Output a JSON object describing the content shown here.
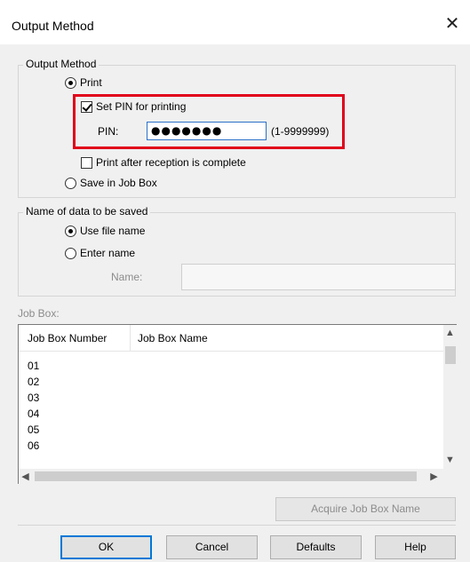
{
  "window": {
    "title": "Output Method",
    "close_glyph": "✕"
  },
  "output_method": {
    "legend": "Output Method",
    "print_label": "Print",
    "print_selected": true,
    "set_pin_label": "Set PIN for printing",
    "set_pin_checked": true,
    "pin_label": "PIN:",
    "pin_value": "●●●●●●●",
    "pin_range": "(1-9999999)",
    "print_after_label": "Print after reception is complete",
    "print_after_checked": false,
    "save_job_box_label": "Save in Job Box",
    "save_job_box_selected": false
  },
  "name_of_data": {
    "legend": "Name of data to be saved",
    "use_file_name_label": "Use file name",
    "use_file_name_selected": true,
    "enter_name_label": "Enter name",
    "enter_name_selected": false,
    "name_label": "Name:",
    "name_value": ""
  },
  "job_box": {
    "label": "Job Box:",
    "columns": [
      "Job Box Number",
      "Job Box Name"
    ],
    "rows": [
      "01",
      "02",
      "03",
      "04",
      "05",
      "06"
    ]
  },
  "buttons": {
    "acquire": "Acquire Job Box Name",
    "ok": "OK",
    "cancel": "Cancel",
    "defaults": "Defaults",
    "help": "Help"
  },
  "colors": {
    "highlight": "#e0001a",
    "focus": "#2b70c9"
  },
  "icons": {
    "close": "close-icon",
    "scroll_up": "chevron-up-icon",
    "scroll_down": "chevron-down-icon",
    "scroll_left": "chevron-left-icon",
    "scroll_right": "chevron-right-icon"
  }
}
